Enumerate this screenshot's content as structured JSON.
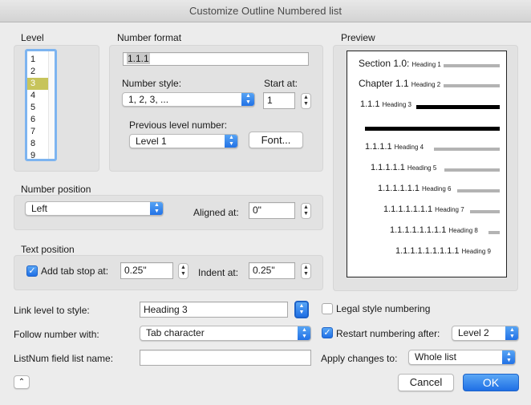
{
  "window": {
    "title": "Customize Outline Numbered list"
  },
  "level": {
    "label": "Level",
    "items": [
      "1",
      "2",
      "3",
      "4",
      "5",
      "6",
      "7",
      "8",
      "9"
    ],
    "selected": "3"
  },
  "number_format": {
    "label": "Number format",
    "value": "1.1.1",
    "number_style_label": "Number style:",
    "number_style_value": "1, 2, 3, ...",
    "start_at_label": "Start at:",
    "start_at_value": "1",
    "previous_level_label": "Previous level number:",
    "previous_level_value": "Level 1",
    "font_button": "Font..."
  },
  "number_position": {
    "label": "Number position",
    "alignment_value": "Left",
    "aligned_at_label": "Aligned at:",
    "aligned_at_value": "0\""
  },
  "text_position": {
    "label": "Text position",
    "add_tab_stop_label": "Add tab stop at:",
    "add_tab_stop_checked": true,
    "tab_stop_value": "0.25\"",
    "indent_at_label": "Indent at:",
    "indent_at_value": "0.25\""
  },
  "preview": {
    "label": "Preview",
    "lines": [
      {
        "number": "Section 1.0:",
        "heading": "Heading 1"
      },
      {
        "number": "Chapter 1.1",
        "heading": "Heading 2"
      },
      {
        "number": "1.1.1",
        "heading": "Heading 3"
      },
      {
        "number": "1.1.1.1",
        "heading": "Heading 4"
      },
      {
        "number": "1.1.1.1.1",
        "heading": "Heading 5"
      },
      {
        "number": "1.1.1.1.1.1",
        "heading": "Heading 6"
      },
      {
        "number": "1.1.1.1.1.1.1",
        "heading": "Heading 7"
      },
      {
        "number": "1.1.1.1.1.1.1.1",
        "heading": "Heading 8"
      },
      {
        "number": "1.1.1.1.1.1.1.1.1",
        "heading": "Heading 9"
      }
    ]
  },
  "link_level": {
    "label": "Link level to style:",
    "value": "Heading 3"
  },
  "follow_number": {
    "label": "Follow number with:",
    "value": "Tab character"
  },
  "listnum": {
    "label": "ListNum field list name:",
    "value": ""
  },
  "legal_style": {
    "label": "Legal style numbering",
    "checked": false
  },
  "restart_numbering": {
    "label": "Restart numbering after:",
    "checked": true,
    "value": "Level 2"
  },
  "apply_changes": {
    "label": "Apply changes to:",
    "value": "Whole list"
  },
  "buttons": {
    "cancel": "Cancel",
    "ok": "OK"
  },
  "colors": {
    "accent": "#2f80ed",
    "selection": "#c7c45b",
    "preview_bar": "#b3b3b3"
  }
}
